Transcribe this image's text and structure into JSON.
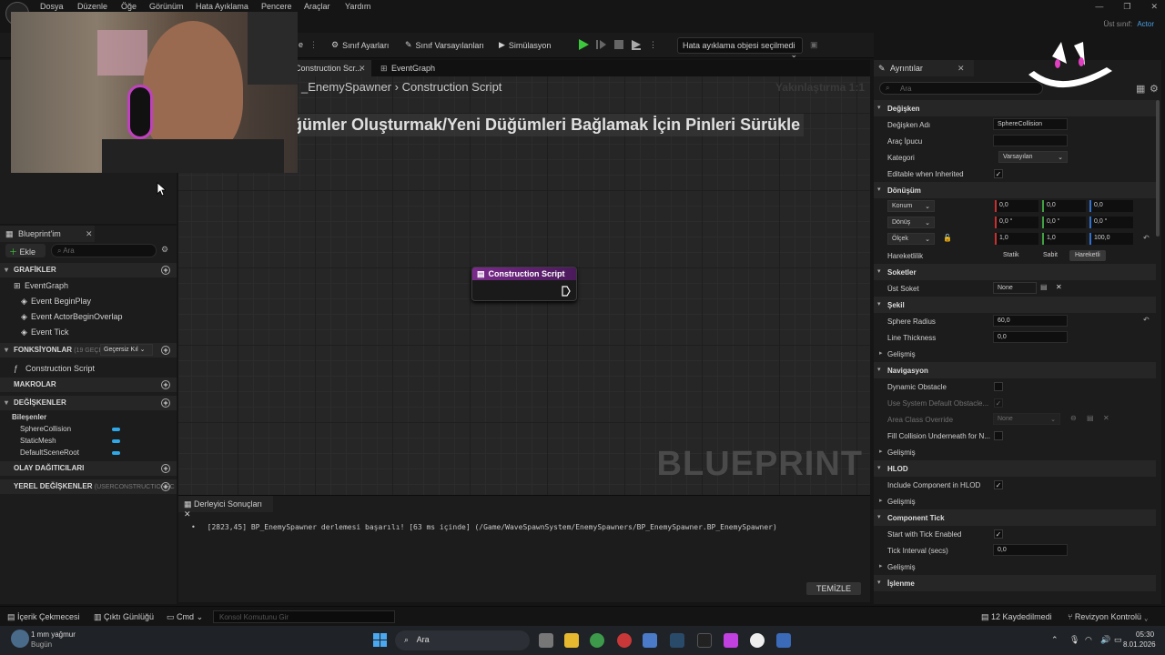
{
  "menu": {
    "items": [
      "Dosya",
      "Düzenle",
      "Öğe",
      "Görünüm",
      "Hata Ayıklama",
      "Pencere",
      "Araçlar",
      "Yardım"
    ]
  },
  "titlebar": {
    "parent_label": "Üst sınıf:",
    "parent_value": "Actor"
  },
  "toolbar": {
    "class_settings": "Sınıf Ayarları",
    "class_defaults": "Sınıf Varsayılanları",
    "simulation": "Simülasyon",
    "debug_object": "Hata ayıklama objesi seçilmedi",
    "partial_label": "e"
  },
  "tabs": {
    "construction": "Construction Scr...",
    "eventgraph": "EventGraph"
  },
  "graph": {
    "breadcrumb_root": "_EnemySpawner",
    "breadcrumb_sep": "›",
    "breadcrumb_leaf": "Construction Script",
    "zoom": "Yakınlaştırma 1:1",
    "hint": "üğümler Oluşturmak/Yeni Düğümleri Bağlamak İçin Pinleri Sürükle",
    "watermark": "BLUEPRINT",
    "node_title": "Construction Script"
  },
  "compiler": {
    "tab": "Derleyici Sonuçları",
    "message": "[2823,45] BP_EnemySpawner derlemesi başarılı! [63 ms içinde] (/Game/WaveSpawnSystem/EnemySpawners/BP_EnemySpawner.BP_EnemySpawner)",
    "clear": "TEMİZLE"
  },
  "my_blueprint": {
    "title": "Blueprint'im",
    "add": "Ekle",
    "search_placeholder": "Ara",
    "graphs_header": "GRAFİKLER",
    "eventgraph": "EventGraph",
    "events": [
      "Event BeginPlay",
      "Event ActorBeginOverlap",
      "Event Tick"
    ],
    "functions_header": "FONKSİYONLAR",
    "functions_count": "(19 GEÇERSİ",
    "functions_dropdown": "Geçersiz Kıl",
    "function_item": "Construction Script",
    "macros_header": "MAKROLAR",
    "variables_header": "DEĞİŞKENLER",
    "components_header": "Bileşenler",
    "components": [
      "SphereCollision",
      "StaticMesh",
      "DefaultSceneRoot"
    ],
    "dispatchers_header": "OLAY DAĞITICILARI",
    "local_vars_header": "YEREL DEĞİŞKENLER",
    "local_vars_suffix": "(USERCONSTRUCTIONSC"
  },
  "details": {
    "title": "Ayrıntılar",
    "search_placeholder": "Ara",
    "variable_section": "Değişken",
    "var_name_label": "Değişken Adı",
    "var_name_value": "SphereCollision",
    "tooltip_label": "Araç İpucu",
    "category_label": "Kategori",
    "category_value": "Varsayılan",
    "editable_label": "Editable when Inherited",
    "transform_section": "Dönüşüm",
    "location_label": "Konum",
    "location": [
      "0,0",
      "0,0",
      "0,0"
    ],
    "rotation_label": "Dönüş",
    "rotation": [
      "0,0 °",
      "0,0 °",
      "0,0 °"
    ],
    "scale_label": "Ölçek",
    "scale": [
      "1,0",
      "1,0",
      "100,0"
    ],
    "mobility_label": "Hareketlilik",
    "mobility_options": [
      "Statik",
      "Sabit",
      "Hareketli"
    ],
    "sockets_section": "Soketler",
    "parent_socket_label": "Üst Soket",
    "parent_socket_value": "None",
    "shape_section": "Şekil",
    "sphere_radius_label": "Sphere Radius",
    "sphere_radius_value": "60,0",
    "line_thickness_label": "Line Thickness",
    "line_thickness_value": "0,0",
    "advanced": "Gelişmiş",
    "navigation_section": "Navigasyon",
    "dynamic_obstacle": "Dynamic Obstacle",
    "use_system_default": "Use System Default Obstacle...",
    "area_class_override": "Area Class Override",
    "area_class_value": "None",
    "fill_collision": "Fill Collision Underneath for N...",
    "hlod_section": "HLOD",
    "include_hlod": "Include Component in HLOD",
    "component_tick_section": "Component Tick",
    "start_tick": "Start with Tick Enabled",
    "tick_interval": "Tick Interval (secs)",
    "tick_interval_value": "0,0",
    "rendering_section": "İşlenme"
  },
  "statusbar": {
    "content_drawer": "İçerik Çekmecesi",
    "output_log": "Çıktı Günlüğü",
    "cmd": "Cmd",
    "console_placeholder": "Konsol Komutunu Gir",
    "saved": "12 Kaydedilmedi",
    "revision": "Revizyon Kontrolü"
  },
  "taskbar": {
    "weather_title": "1 mm yağmur",
    "weather_sub": "Bugün",
    "search": "Ara",
    "time": "05:30",
    "date": "8.01.2026"
  },
  "colors": {
    "accent": "#4aa0e6",
    "node_header": "#7a2a8c",
    "pin_blue": "#2ea8e8",
    "play_green": "#3cc83c"
  }
}
